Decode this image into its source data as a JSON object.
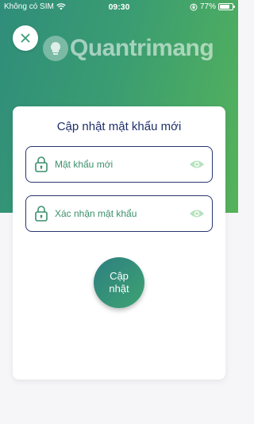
{
  "status_bar": {
    "carrier": "Không có SIM",
    "time": "09:30",
    "battery_percent": "77%",
    "battery_level": 0.77,
    "icons": [
      "wifi-icon",
      "orientation-lock-icon",
      "battery-icon"
    ]
  },
  "header": {
    "close_icon": "close-icon",
    "watermark_text": "Quantrimang"
  },
  "form": {
    "title": "Cập nhật mật khẩu mới",
    "new_password": {
      "placeholder": "Mật khẩu mới",
      "value": "",
      "icon": "lock-icon",
      "toggle_icon": "eye-icon"
    },
    "confirm_password": {
      "placeholder": "Xác nhận mật khẩu",
      "value": "",
      "icon": "lock-icon",
      "toggle_icon": "eye-icon"
    },
    "submit_label": "Cập nhật"
  },
  "colors": {
    "gradient_start": "#2f8d7a",
    "gradient_end": "#55b35a",
    "title_color": "#1e2f6a",
    "field_border": "#2a3570",
    "placeholder_color": "#3b8f6a",
    "eye_color": "#9fd4a8"
  }
}
